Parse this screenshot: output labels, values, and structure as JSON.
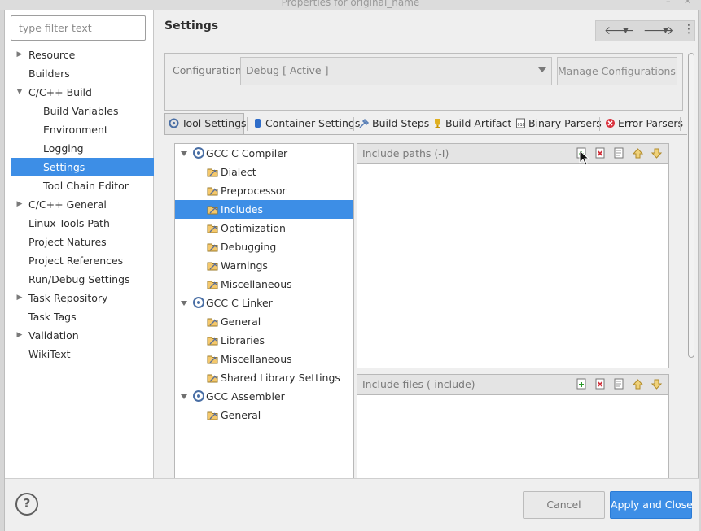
{
  "window": {
    "title": "Properties for original_name"
  },
  "filter": {
    "placeholder": "type filter text"
  },
  "nav": [
    {
      "label": "Resource",
      "expander": "collapsed",
      "indent": 0
    },
    {
      "label": "Builders",
      "expander": "none",
      "indent": 0
    },
    {
      "label": "C/C++ Build",
      "expander": "expanded",
      "indent": 0
    },
    {
      "label": "Build Variables",
      "expander": "none",
      "indent": 1
    },
    {
      "label": "Environment",
      "expander": "none",
      "indent": 1
    },
    {
      "label": "Logging",
      "expander": "none",
      "indent": 1
    },
    {
      "label": "Settings",
      "expander": "none",
      "indent": 1,
      "selected": true
    },
    {
      "label": "Tool Chain Editor",
      "expander": "none",
      "indent": 1
    },
    {
      "label": "C/C++ General",
      "expander": "collapsed",
      "indent": 0
    },
    {
      "label": "Linux Tools Path",
      "expander": "none",
      "indent": 0
    },
    {
      "label": "Project Natures",
      "expander": "none",
      "indent": 0
    },
    {
      "label": "Project References",
      "expander": "none",
      "indent": 0
    },
    {
      "label": "Run/Debug Settings",
      "expander": "none",
      "indent": 0
    },
    {
      "label": "Task Repository",
      "expander": "collapsed",
      "indent": 0
    },
    {
      "label": "Task Tags",
      "expander": "none",
      "indent": 0
    },
    {
      "label": "Validation",
      "expander": "collapsed",
      "indent": 0
    },
    {
      "label": "WikiText",
      "expander": "none",
      "indent": 0
    }
  ],
  "page": {
    "title": "Settings",
    "config_label": "Configuration:",
    "config_value": "Debug  [ Active ]",
    "manage_label": "Manage Configurations..."
  },
  "tabs": [
    {
      "label": "Tool Settings",
      "icon": "tool-settings-icon",
      "active": true
    },
    {
      "label": "Container Settings",
      "icon": "container-icon"
    },
    {
      "label": "Build Steps",
      "icon": "build-steps-icon"
    },
    {
      "label": "Build Artifact",
      "icon": "build-artifact-icon"
    },
    {
      "label": "Binary Parsers",
      "icon": "binary-parsers-icon"
    },
    {
      "label": "Error Parsers",
      "icon": "error-parsers-icon"
    }
  ],
  "tool_tree": [
    {
      "label": "GCC C Compiler",
      "kind": "tool"
    },
    {
      "label": "Dialect",
      "kind": "option"
    },
    {
      "label": "Preprocessor",
      "kind": "option"
    },
    {
      "label": "Includes",
      "kind": "option",
      "selected": true
    },
    {
      "label": "Optimization",
      "kind": "option"
    },
    {
      "label": "Debugging",
      "kind": "option"
    },
    {
      "label": "Warnings",
      "kind": "option"
    },
    {
      "label": "Miscellaneous",
      "kind": "option"
    },
    {
      "label": "GCC C Linker",
      "kind": "tool"
    },
    {
      "label": "General",
      "kind": "option"
    },
    {
      "label": "Libraries",
      "kind": "option"
    },
    {
      "label": "Miscellaneous",
      "kind": "option"
    },
    {
      "label": "Shared Library Settings",
      "kind": "option"
    },
    {
      "label": "GCC Assembler",
      "kind": "tool"
    },
    {
      "label": "General",
      "kind": "option"
    }
  ],
  "panels": {
    "include_paths": "Include paths (-I)",
    "include_files": "Include files (-include)"
  },
  "buttons": {
    "cancel": "Cancel",
    "apply": "Apply and Close",
    "help": "?"
  },
  "colors": {
    "selection": "#3d8ee6",
    "accent_button": "#3d8ee6"
  }
}
